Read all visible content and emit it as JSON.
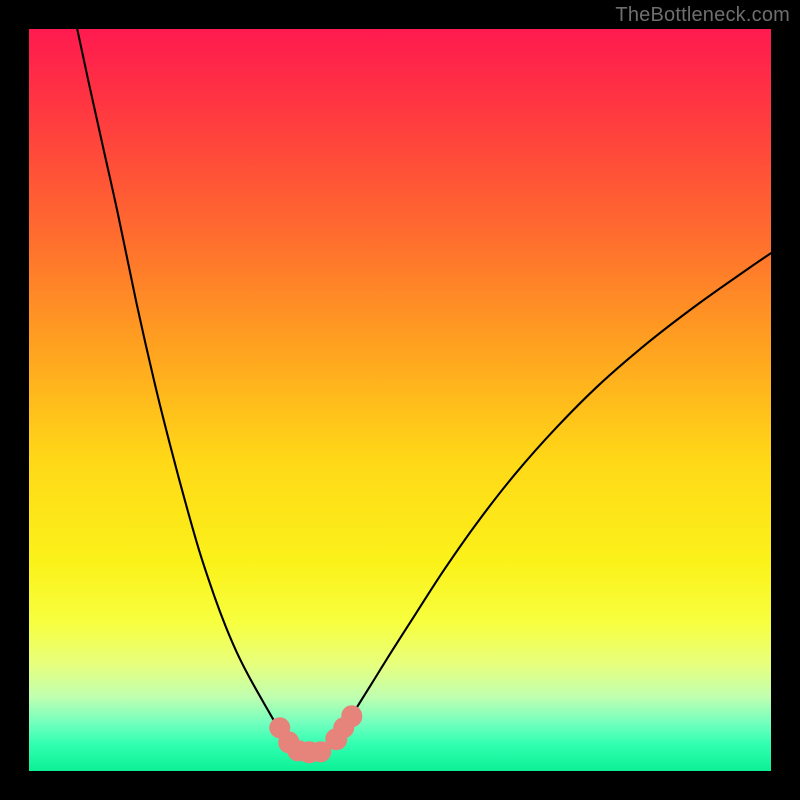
{
  "watermark": "TheBottleneck.com",
  "chart_data": {
    "type": "line",
    "title": "",
    "xlabel": "",
    "ylabel": "",
    "xlim": [
      0,
      100
    ],
    "ylim": [
      0,
      100
    ],
    "background_gradient": {
      "stops": [
        {
          "offset": 0.0,
          "color": "#ff1a4f"
        },
        {
          "offset": 0.12,
          "color": "#ff3b3f"
        },
        {
          "offset": 0.28,
          "color": "#ff6d2e"
        },
        {
          "offset": 0.44,
          "color": "#ffa61f"
        },
        {
          "offset": 0.58,
          "color": "#ffd817"
        },
        {
          "offset": 0.72,
          "color": "#fbf21a"
        },
        {
          "offset": 0.8,
          "color": "#f7ff3f"
        },
        {
          "offset": 0.855,
          "color": "#e8ff7c"
        },
        {
          "offset": 0.9,
          "color": "#c0ffb0"
        },
        {
          "offset": 0.935,
          "color": "#73ffbf"
        },
        {
          "offset": 0.965,
          "color": "#2fffb0"
        },
        {
          "offset": 1.0,
          "color": "#0cf095"
        }
      ]
    },
    "series": [
      {
        "name": "left-branch",
        "x": [
          6.5,
          8,
          10,
          12,
          14.5,
          17,
          19,
          21,
          23,
          25,
          26.5,
          28,
          29.5,
          31,
          32.2,
          33.2,
          34.2,
          35,
          35.8,
          36.5
        ],
        "y": [
          100,
          93,
          84,
          75,
          63,
          52,
          44,
          36.5,
          29.5,
          23.5,
          19.5,
          16,
          13,
          10.3,
          8.2,
          6.5,
          5.1,
          4.2,
          3.4,
          2.9
        ]
      },
      {
        "name": "right-branch",
        "x": [
          40.2,
          40.8,
          41.6,
          42.7,
          44.2,
          46.2,
          48.8,
          52,
          56,
          60.5,
          65.5,
          71,
          77,
          83.5,
          90,
          96.5,
          100
        ],
        "y": [
          2.9,
          3.6,
          4.7,
          6.2,
          8.6,
          11.8,
          16,
          21,
          27.2,
          33.6,
          40,
          46.2,
          52.2,
          57.8,
          62.8,
          67.4,
          69.8
        ]
      },
      {
        "name": "trough-flat",
        "x": [
          36.5,
          37.2,
          38.3,
          39.3,
          40.2
        ],
        "y": [
          2.9,
          2.7,
          2.55,
          2.7,
          2.9
        ]
      }
    ],
    "discs": [
      {
        "x": 33.8,
        "y": 5.8,
        "r": 1.45
      },
      {
        "x": 35.0,
        "y": 3.9,
        "r": 1.45
      },
      {
        "x": 36.3,
        "y": 2.7,
        "r": 1.45
      },
      {
        "x": 37.8,
        "y": 2.55,
        "r": 1.45
      },
      {
        "x": 39.3,
        "y": 2.6,
        "r": 1.45
      },
      {
        "x": 41.4,
        "y": 4.3,
        "r": 1.45
      },
      {
        "x": 42.4,
        "y": 5.8,
        "r": 1.45
      },
      {
        "x": 43.5,
        "y": 7.4,
        "r": 1.45
      }
    ]
  }
}
